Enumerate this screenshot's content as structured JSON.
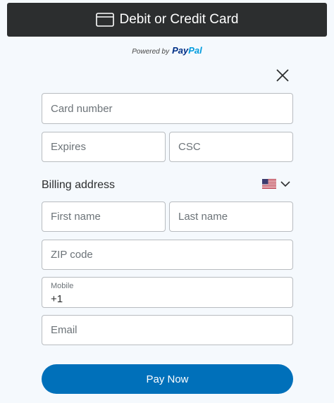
{
  "header": {
    "title": "Debit or Credit Card",
    "icon": "credit-card-icon"
  },
  "powered_by": {
    "prefix": "Powered by",
    "brand_part1": "Pay",
    "brand_part2": "Pal"
  },
  "close": {
    "icon": "close-icon"
  },
  "card": {
    "number_placeholder": "Card number",
    "expires_placeholder": "Expires",
    "csc_placeholder": "CSC"
  },
  "billing": {
    "label": "Billing address",
    "country_flag": "us-flag-icon",
    "dropdown_icon": "chevron-down-icon",
    "first_name_placeholder": "First name",
    "last_name_placeholder": "Last name",
    "zip_placeholder": "ZIP code",
    "mobile_label": "Mobile",
    "mobile_value": "+1",
    "email_placeholder": "Email"
  },
  "pay_button": {
    "label": "Pay Now"
  },
  "colors": {
    "header_bg": "#2c2e2f",
    "page_bg": "#f5f9fd",
    "button_bg": "#0070ba",
    "paypal_dark": "#003087",
    "paypal_light": "#009cde"
  }
}
